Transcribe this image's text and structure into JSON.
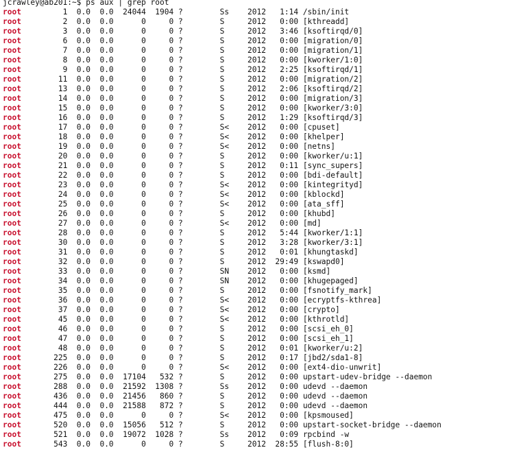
{
  "terminal": {
    "prompt": "jcrawley@ab201:~$ ps aux | grep root",
    "highlight_color": "#c8102e",
    "rows": [
      {
        "user": "root",
        "rest": "         1  0.0  0.0  24044  1904 ?        Ss    2012   1:14 /sbin/init"
      },
      {
        "user": "root",
        "rest": "         2  0.0  0.0      0     0 ?        S     2012   0:00 [kthreadd]"
      },
      {
        "user": "root",
        "rest": "         3  0.0  0.0      0     0 ?        S     2012   3:46 [ksoftirqd/0]"
      },
      {
        "user": "root",
        "rest": "         6  0.0  0.0      0     0 ?        S     2012   0:00 [migration/0]"
      },
      {
        "user": "root",
        "rest": "         7  0.0  0.0      0     0 ?        S     2012   0:00 [migration/1]"
      },
      {
        "user": "root",
        "rest": "         8  0.0  0.0      0     0 ?        S     2012   0:00 [kworker/1:0]"
      },
      {
        "user": "root",
        "rest": "         9  0.0  0.0      0     0 ?        S     2012   2:25 [ksoftirqd/1]"
      },
      {
        "user": "root",
        "rest": "        11  0.0  0.0      0     0 ?        S     2012   0:00 [migration/2]"
      },
      {
        "user": "root",
        "rest": "        13  0.0  0.0      0     0 ?        S     2012   2:06 [ksoftirqd/2]"
      },
      {
        "user": "root",
        "rest": "        14  0.0  0.0      0     0 ?        S     2012   0:00 [migration/3]"
      },
      {
        "user": "root",
        "rest": "        15  0.0  0.0      0     0 ?        S     2012   0:00 [kworker/3:0]"
      },
      {
        "user": "root",
        "rest": "        16  0.0  0.0      0     0 ?        S     2012   1:29 [ksoftirqd/3]"
      },
      {
        "user": "root",
        "rest": "        17  0.0  0.0      0     0 ?        S<    2012   0:00 [cpuset]"
      },
      {
        "user": "root",
        "rest": "        18  0.0  0.0      0     0 ?        S<    2012   0:00 [khelper]"
      },
      {
        "user": "root",
        "rest": "        19  0.0  0.0      0     0 ?        S<    2012   0:00 [netns]"
      },
      {
        "user": "root",
        "rest": "        20  0.0  0.0      0     0 ?        S     2012   0:00 [kworker/u:1]"
      },
      {
        "user": "root",
        "rest": "        21  0.0  0.0      0     0 ?        S     2012   0:11 [sync_supers]"
      },
      {
        "user": "root",
        "rest": "        22  0.0  0.0      0     0 ?        S     2012   0:00 [bdi-default]"
      },
      {
        "user": "root",
        "rest": "        23  0.0  0.0      0     0 ?        S<    2012   0:00 [kintegrityd]"
      },
      {
        "user": "root",
        "rest": "        24  0.0  0.0      0     0 ?        S<    2012   0:00 [kblockd]"
      },
      {
        "user": "root",
        "rest": "        25  0.0  0.0      0     0 ?        S<    2012   0:00 [ata_sff]"
      },
      {
        "user": "root",
        "rest": "        26  0.0  0.0      0     0 ?        S     2012   0:00 [khubd]"
      },
      {
        "user": "root",
        "rest": "        27  0.0  0.0      0     0 ?        S<    2012   0:00 [md]"
      },
      {
        "user": "root",
        "rest": "        28  0.0  0.0      0     0 ?        S     2012   5:44 [kworker/1:1]"
      },
      {
        "user": "root",
        "rest": "        30  0.0  0.0      0     0 ?        S     2012   3:28 [kworker/3:1]"
      },
      {
        "user": "root",
        "rest": "        31  0.0  0.0      0     0 ?        S     2012   0:01 [khungtaskd]"
      },
      {
        "user": "root",
        "rest": "        32  0.0  0.0      0     0 ?        S     2012  29:49 [kswapd0]"
      },
      {
        "user": "root",
        "rest": "        33  0.0  0.0      0     0 ?        SN    2012   0:00 [ksmd]"
      },
      {
        "user": "root",
        "rest": "        34  0.0  0.0      0     0 ?        SN    2012   0:00 [khugepaged]"
      },
      {
        "user": "root",
        "rest": "        35  0.0  0.0      0     0 ?        S     2012   0:00 [fsnotify_mark]"
      },
      {
        "user": "root",
        "rest": "        36  0.0  0.0      0     0 ?        S<    2012   0:00 [ecryptfs-kthrea]"
      },
      {
        "user": "root",
        "rest": "        37  0.0  0.0      0     0 ?        S<    2012   0:00 [crypto]"
      },
      {
        "user": "root",
        "rest": "        45  0.0  0.0      0     0 ?        S<    2012   0:00 [kthrotld]"
      },
      {
        "user": "root",
        "rest": "        46  0.0  0.0      0     0 ?        S     2012   0:00 [scsi_eh_0]"
      },
      {
        "user": "root",
        "rest": "        47  0.0  0.0      0     0 ?        S     2012   0:00 [scsi_eh_1]"
      },
      {
        "user": "root",
        "rest": "        48  0.0  0.0      0     0 ?        S     2012   0:01 [kworker/u:2]"
      },
      {
        "user": "root",
        "rest": "       225  0.0  0.0      0     0 ?        S     2012   0:17 [jbd2/sda1-8]"
      },
      {
        "user": "root",
        "rest": "       226  0.0  0.0      0     0 ?        S<    2012   0:00 [ext4-dio-unwrit]"
      },
      {
        "user": "root",
        "rest": "       275  0.0  0.0  17104   532 ?        S     2012   0:00 upstart-udev-bridge --daemon"
      },
      {
        "user": "root",
        "rest": "       288  0.0  0.0  21592  1308 ?        Ss    2012   0:00 udevd --daemon"
      },
      {
        "user": "root",
        "rest": "       436  0.0  0.0  21456   860 ?        S     2012   0:00 udevd --daemon"
      },
      {
        "user": "root",
        "rest": "       444  0.0  0.0  21588   872 ?        S     2012   0:00 udevd --daemon"
      },
      {
        "user": "root",
        "rest": "       475  0.0  0.0      0     0 ?        S<    2012   0:00 [kpsmoused]"
      },
      {
        "user": "root",
        "rest": "       520  0.0  0.0  15056   512 ?        S     2012   0:00 upstart-socket-bridge --daemon"
      },
      {
        "user": "root",
        "rest": "       521  0.0  0.0  19072  1028 ?        Ss    2012   0:09 rpcbind -w"
      },
      {
        "user": "root",
        "rest": "       543  0.0  0.0      0     0 ?        S     2012  28:55 [flush-8:0]"
      }
    ]
  }
}
